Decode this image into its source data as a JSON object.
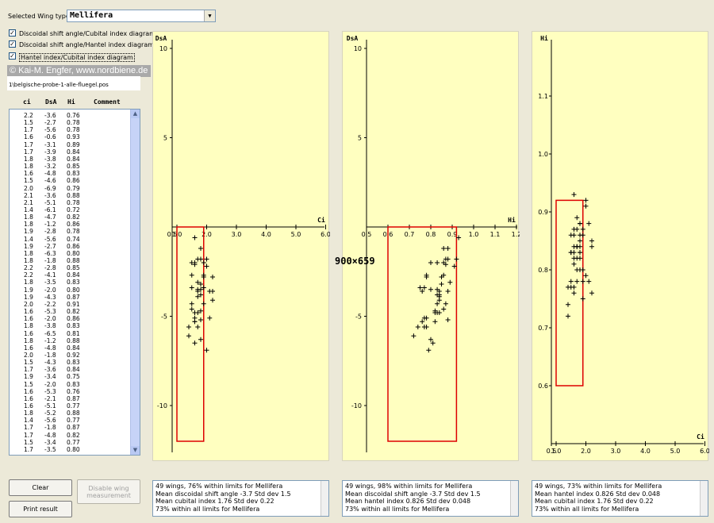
{
  "wing_type": {
    "label": "Selected Wing type:",
    "value": "Mellifera"
  },
  "options": [
    {
      "label": "Discoidal shift angle/Cubital index diagram",
      "checked": true
    },
    {
      "label": "Discoidal shift angle/Hantel index diagram",
      "checked": true
    },
    {
      "label": "Hantel index/Cubital index diagram",
      "checked": true
    }
  ],
  "copyright": "© Kai-M. Engfer, www.nordbiene.de",
  "file_path": "1\\belgische-probe-1-alle-fluegel.pos",
  "table": {
    "headers": [
      "ci",
      "DsA",
      "Hi",
      "Comment"
    ],
    "rows": [
      [
        "2.2",
        "-3.6",
        "0.76"
      ],
      [
        "1.5",
        "-2.7",
        "0.78"
      ],
      [
        "1.7",
        "-5.6",
        "0.78"
      ],
      [
        "1.6",
        "-0.6",
        "0.93"
      ],
      [
        "1.7",
        "-3.1",
        "0.89"
      ],
      [
        "1.7",
        "-3.9",
        "0.84"
      ],
      [
        "1.8",
        "-3.8",
        "0.84"
      ],
      [
        "1.8",
        "-3.2",
        "0.85"
      ],
      [
        "1.6",
        "-4.8",
        "0.83"
      ],
      [
        "1.5",
        "-4.6",
        "0.86"
      ],
      [
        "2.0",
        "-6.9",
        "0.79"
      ],
      [
        "2.1",
        "-3.6",
        "0.88"
      ],
      [
        "2.1",
        "-5.1",
        "0.78"
      ],
      [
        "1.4",
        "-6.1",
        "0.72"
      ],
      [
        "1.8",
        "-4.7",
        "0.82"
      ],
      [
        "1.8",
        "-1.2",
        "0.86"
      ],
      [
        "1.9",
        "-2.8",
        "0.78"
      ],
      [
        "1.4",
        "-5.6",
        "0.74"
      ],
      [
        "1.9",
        "-2.7",
        "0.86"
      ],
      [
        "1.8",
        "-6.3",
        "0.80"
      ],
      [
        "1.8",
        "-1.8",
        "0.88"
      ],
      [
        "2.2",
        "-2.8",
        "0.85"
      ],
      [
        "2.2",
        "-4.1",
        "0.84"
      ],
      [
        "1.8",
        "-3.5",
        "0.83"
      ],
      [
        "1.9",
        "-2.0",
        "0.80"
      ],
      [
        "1.9",
        "-4.3",
        "0.87"
      ],
      [
        "2.0",
        "-2.2",
        "0.91"
      ],
      [
        "1.6",
        "-5.3",
        "0.82"
      ],
      [
        "1.6",
        "-2.0",
        "0.86"
      ],
      [
        "1.8",
        "-3.8",
        "0.83"
      ],
      [
        "1.6",
        "-6.5",
        "0.81"
      ],
      [
        "1.8",
        "-1.2",
        "0.88"
      ],
      [
        "1.6",
        "-4.8",
        "0.84"
      ],
      [
        "2.0",
        "-1.8",
        "0.92"
      ],
      [
        "1.5",
        "-4.3",
        "0.83"
      ],
      [
        "1.7",
        "-3.6",
        "0.84"
      ],
      [
        "1.9",
        "-3.4",
        "0.75"
      ],
      [
        "1.5",
        "-2.0",
        "0.83"
      ],
      [
        "1.6",
        "-5.3",
        "0.76"
      ],
      [
        "1.6",
        "-2.1",
        "0.87"
      ],
      [
        "1.6",
        "-5.1",
        "0.77"
      ],
      [
        "1.8",
        "-5.2",
        "0.88"
      ],
      [
        "1.4",
        "-5.6",
        "0.77"
      ],
      [
        "1.7",
        "-1.8",
        "0.87"
      ],
      [
        "1.7",
        "-4.8",
        "0.82"
      ],
      [
        "1.5",
        "-3.4",
        "0.77"
      ],
      [
        "1.7",
        "-3.5",
        "0.80"
      ]
    ]
  },
  "chart_data": [
    {
      "type": "scatter",
      "name": "Discoidal shift angle/Cubital index diagram",
      "xlabel": "Ci",
      "ylabel": "DsA",
      "xlim": [
        0.5,
        6.0
      ],
      "ylim": [
        -12,
        10.5
      ],
      "xticks": [
        "0.5",
        "1.0",
        "2.0",
        "3.0",
        "4.0",
        "5.0",
        "6.0"
      ],
      "yticks": [
        "10",
        "5",
        "-5",
        "-10"
      ],
      "limit_box": {
        "x": [
          1.0,
          1.9
        ],
        "y": [
          -12,
          0
        ]
      },
      "marker": "+"
    },
    {
      "type": "scatter",
      "name": "Discoidal shift angle/Hantel index diagram",
      "xlabel": "Hi",
      "ylabel": "DsA",
      "xlim": [
        0.5,
        1.2
      ],
      "ylim": [
        -12,
        10.5
      ],
      "xticks": [
        "0.5",
        "0.6",
        "0.7",
        "0.8",
        "0.9",
        "1.0",
        "1.1",
        "1.2"
      ],
      "yticks": [
        "10",
        "5",
        "-5",
        "-10"
      ],
      "limit_box": {
        "x": [
          0.6,
          0.92
        ],
        "y": [
          -12,
          0
        ]
      },
      "marker": "+"
    },
    {
      "type": "scatter",
      "name": "Hantel index/Cubital index diagram",
      "xlabel": "Ci",
      "ylabel": "Hi",
      "xlim": [
        0.5,
        6.0
      ],
      "ylim": [
        0.5,
        1.2
      ],
      "xticks": [
        "0.5",
        "1.0",
        "2.0",
        "3.0",
        "4.0",
        "5.0",
        "6.0"
      ],
      "yticks": [
        "1.1",
        "1.0",
        "0.9",
        "0.8",
        "0.7",
        "0.6"
      ],
      "limit_box": {
        "x": [
          1.0,
          1.9
        ],
        "y": [
          0.6,
          0.92
        ]
      },
      "marker": "+"
    }
  ],
  "results": [
    [
      "49 wings, 76% within limits for Mellifera",
      " Mean discoidal shift angle -3.7  Std dev 1.5",
      " Mean cubital index 1.76     Std dev 0.22",
      "73% within all limits for Mellifera"
    ],
    [
      "49 wings, 98% within limits for Mellifera",
      " Mean discoidal shift angle -3.7  Std dev 1.5",
      " Mean hantel index 0.826       Std dev 0.048",
      "73% within all limits for Mellifera"
    ],
    [
      "49 wings, 73% within limits for Mellifera",
      " Mean hantel index 0.826       Std dev 0.048",
      " Mean cubital index 1.76     Std dev 0.22",
      "73% within all limits for Mellifera"
    ]
  ],
  "buttons": {
    "clear": "Clear",
    "print": "Print result",
    "disable": "Disable wing measurement"
  },
  "center_label": "900×659",
  "colors": {
    "panel_bg": "#ffffc0",
    "limit_box": "#dd0000",
    "window_bg": "#ece9d8"
  }
}
